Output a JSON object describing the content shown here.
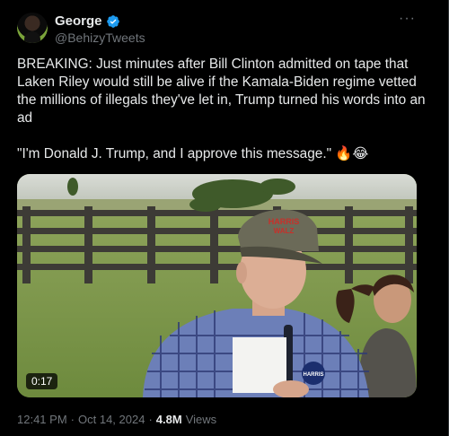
{
  "author": {
    "display_name": "George",
    "handle": "@BehizyTweets",
    "avatar_icon": "user-avatar-icon",
    "verified_icon": "verified-badge-icon",
    "verified_color": "#1d9bf0"
  },
  "more_label": "···",
  "tweet_text": "BREAKING: Just minutes after Bill Clinton admitted on tape that Laken Riley would still be alive if the Kamala-Biden regime vetted the millions of illegals they've let in, Trump turned his words into an ad\n\n\"I'm Donald J. Trump, and I approve this message.\" 🔥😂",
  "media": {
    "duration": "0:17",
    "hat_text_line1": "HARRIS",
    "hat_text_line2": "WALZ",
    "badge_text": "HARRIS"
  },
  "meta": {
    "time": "12:41 PM",
    "separator1": "·",
    "date": "Oct 14, 2024",
    "separator2": "·",
    "views_count": "4.8M",
    "views_label": "Views"
  }
}
